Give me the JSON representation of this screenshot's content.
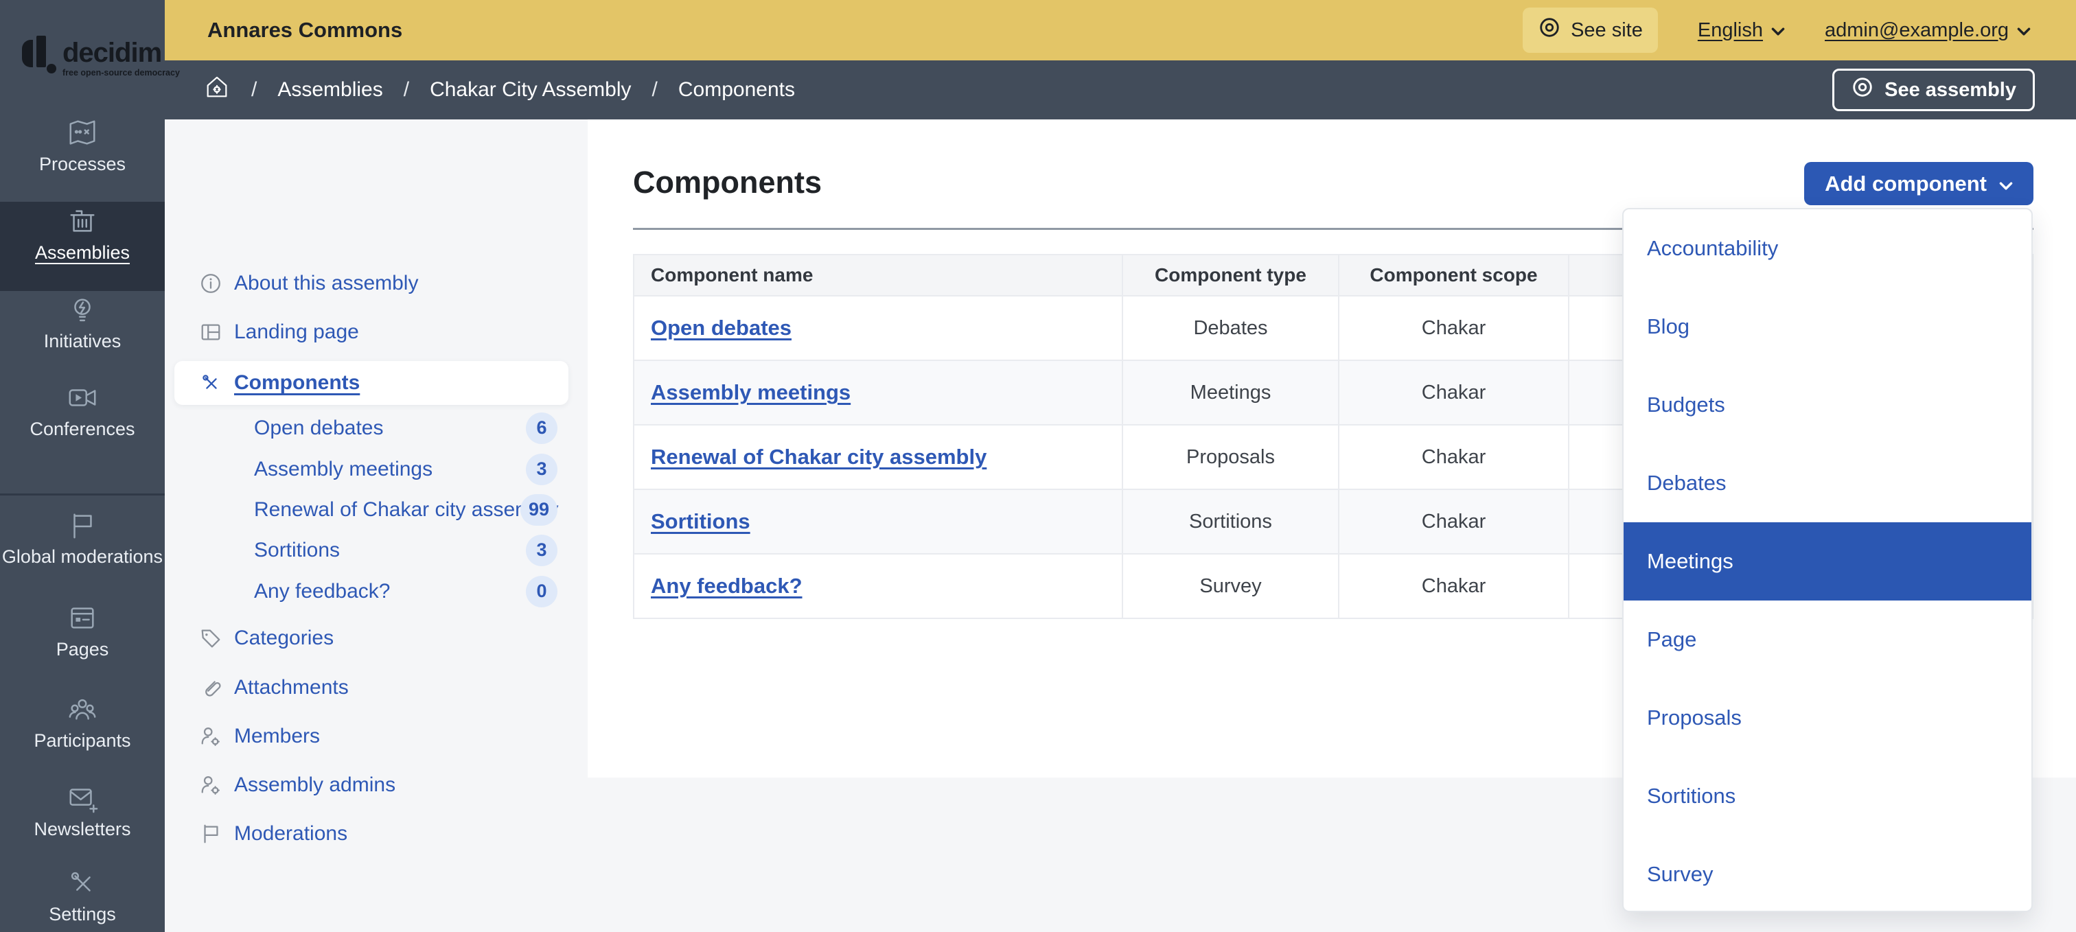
{
  "topbar": {
    "org_name": "Annares Commons",
    "see_site": "See site",
    "language": "English",
    "user_email": "admin@example.org"
  },
  "logo": {
    "brand": "decidim",
    "tagline": "free open-source democracy"
  },
  "breadcrumb": {
    "separator": "/",
    "items": [
      "Assemblies",
      "Chakar City Assembly",
      "Components"
    ],
    "see_assembly": "See assembly"
  },
  "rail": {
    "items": [
      {
        "label": "Processes"
      },
      {
        "label": "Assemblies"
      },
      {
        "label": "Initiatives"
      },
      {
        "label": "Conferences"
      },
      {
        "label": "Global moderations"
      },
      {
        "label": "Pages"
      },
      {
        "label": "Participants"
      },
      {
        "label": "Newsletters"
      },
      {
        "label": "Settings"
      }
    ]
  },
  "sidebar": {
    "about": "About this assembly",
    "landing": "Landing page",
    "components": "Components",
    "children": [
      {
        "label": "Open debates",
        "count": "6"
      },
      {
        "label": "Assembly meetings",
        "count": "3"
      },
      {
        "label": "Renewal of Chakar city assembly",
        "count": "99"
      },
      {
        "label": "Sortitions",
        "count": "3"
      },
      {
        "label": "Any feedback?",
        "count": "0"
      }
    ],
    "categories": "Categories",
    "attachments": "Attachments",
    "members": "Members",
    "admins": "Assembly admins",
    "moderations": "Moderations"
  },
  "main": {
    "title": "Components",
    "add_component": "Add component",
    "table": {
      "columns": [
        "Component name",
        "Component type",
        "Component scope"
      ],
      "rows": [
        {
          "name": "Open debates",
          "type": "Debates",
          "scope": "Chakar"
        },
        {
          "name": "Assembly meetings",
          "type": "Meetings",
          "scope": "Chakar"
        },
        {
          "name": "Renewal of Chakar city assembly",
          "type": "Proposals",
          "scope": "Chakar"
        },
        {
          "name": "Sortitions",
          "type": "Sortitions",
          "scope": "Chakar"
        },
        {
          "name": "Any feedback?",
          "type": "Survey",
          "scope": "Chakar"
        }
      ]
    }
  },
  "dropdown": {
    "items": [
      "Accountability",
      "Blog",
      "Budgets",
      "Debates",
      "Meetings",
      "Page",
      "Proposals",
      "Sortitions",
      "Survey"
    ],
    "highlighted": "Meetings"
  },
  "colors": {
    "topbar_gold": "#E3C567",
    "header_slate": "#424C5A",
    "primary_blue": "#2C58B4",
    "badge_bg": "#DFE9F9"
  }
}
